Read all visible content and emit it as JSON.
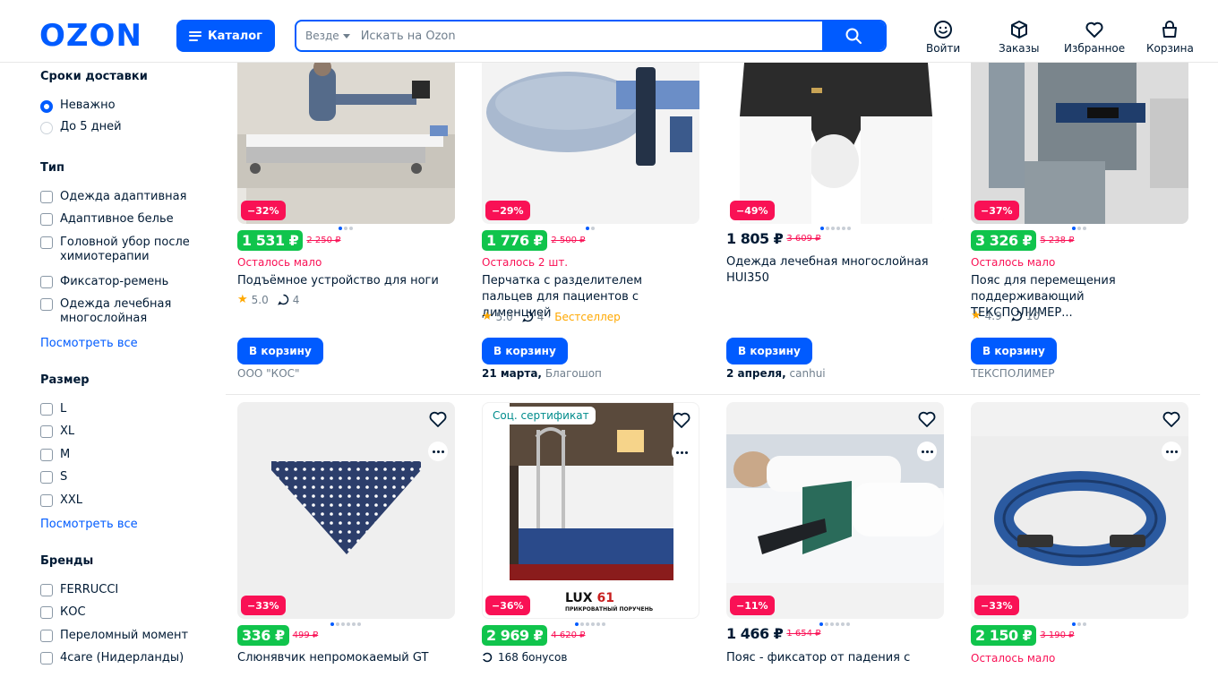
{
  "header": {
    "logo": "OZON",
    "catalog_label": "Каталог",
    "search_scope": "Везде",
    "search_placeholder": "Искать на Ozon",
    "nav": [
      {
        "label": "Войти",
        "icon": "face-icon"
      },
      {
        "label": "Заказы",
        "icon": "box-icon"
      },
      {
        "label": "Избранное",
        "icon": "heart-icon"
      },
      {
        "label": "Корзина",
        "icon": "basket-icon"
      }
    ]
  },
  "sidebar": {
    "delivery": {
      "title": "Сроки доставки",
      "options": [
        {
          "label": "Неважно",
          "selected": true
        },
        {
          "label": "До 5 дней",
          "selected": false
        }
      ]
    },
    "type": {
      "title": "Тип",
      "options": [
        "Одежда адаптивная",
        "Адаптивное белье",
        "Головной убор после химиотерапии",
        "Фиксатор-ремень",
        "Одежда лечебная многослойная"
      ],
      "see_all": "Посмотреть все"
    },
    "size": {
      "title": "Размер",
      "options": [
        "L",
        "XL",
        "M",
        "S",
        "XXL"
      ],
      "see_all": "Посмотреть все"
    },
    "brands": {
      "title": "Бренды",
      "options": [
        "FERRUCCI",
        "КОС",
        "Переломный момент",
        "4care (Нидерланды)"
      ]
    }
  },
  "products_row1": [
    {
      "discount": "−32%",
      "price": "1 531 ₽",
      "old_price": "2 250 ₽",
      "stock": "Осталось мало",
      "title": "Подъёмное устройство для ноги",
      "rating": "5.0",
      "reviews": "4",
      "button": "В корзину",
      "seller_date": "",
      "seller": "ООО \"КОС\""
    },
    {
      "discount": "−29%",
      "price": "1 776 ₽",
      "old_price": "2 500 ₽",
      "stock": "Осталось 2 шт.",
      "title": "Перчатка с разделителем пальцев для пациентов с дименцией",
      "rating": "5.0",
      "reviews": "4",
      "badge": "Бестселлер",
      "button": "В корзину",
      "seller_date": "21 марта,",
      "seller": "Благошоп"
    },
    {
      "discount": "−49%",
      "price": "1 805 ₽",
      "old_price": "3 609 ₽",
      "stock": "",
      "title": "Одежда лечебная многослойная HUI350",
      "button": "В корзину",
      "seller_date": "2 апреля,",
      "seller": "canhui"
    },
    {
      "discount": "−37%",
      "price": "3 326 ₽",
      "old_price": "5 238 ₽",
      "stock": "Осталось мало",
      "title": "Пояс для перемещения поддерживающий ТЕКСПОЛИМЕР...",
      "rating": "4.9",
      "reviews": "10",
      "button": "В корзину",
      "seller_date": "",
      "seller": "ТЕКСПОЛИМЕР"
    }
  ],
  "products_row2": [
    {
      "discount": "−33%",
      "price": "336 ₽",
      "old_price": "499 ₽",
      "title": "Слюнявчик непромокаемый GT"
    },
    {
      "discount": "−36%",
      "price": "2 969 ₽",
      "old_price": "4 620 ₽",
      "cert": "Соц. сертификат",
      "bonus": "168 бонусов",
      "product_brand": "LUX",
      "product_brand_num": "61",
      "product_caption": "ПРИКРОВАТНЫЙ ПОРУЧЕНЬ"
    },
    {
      "discount": "−11%",
      "price": "1 466 ₽",
      "old_price": "1 654 ₽",
      "title": "Пояс - фиксатор от падения с"
    },
    {
      "discount": "−33%",
      "price": "2 150 ₽",
      "old_price": "3 190 ₽",
      "stock": "Осталось мало"
    }
  ],
  "colors": {
    "brand": "#005bff",
    "discount": "#f91155",
    "price_green": "#10c44c",
    "star": "#ffa800"
  }
}
